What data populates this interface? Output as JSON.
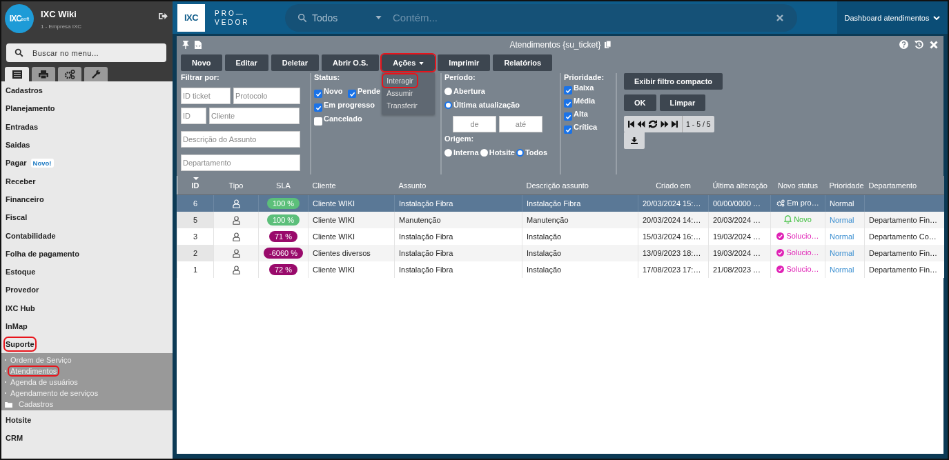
{
  "sidebar": {
    "logo": {
      "main": "IXC",
      "suffix": "soft"
    },
    "title": "IXC Wiki",
    "subtitle": "1 - Empresa IXC",
    "search": {
      "placeholder": "Buscar no menu..."
    },
    "tabs": [
      {
        "kind": "list",
        "selected": true
      },
      {
        "kind": "print",
        "selected": false
      },
      {
        "kind": "gears",
        "selected": false
      },
      {
        "kind": "wrench",
        "selected": false
      }
    ],
    "menu": [
      {
        "label": "Cadastros",
        "highlighted": false
      },
      {
        "label": "Planejamento",
        "highlighted": false
      },
      {
        "label": "Entradas",
        "highlighted": false
      },
      {
        "label": "Saidas",
        "highlighted": false
      },
      {
        "label": "Pagar",
        "badge": "Novo!",
        "highlighted": false
      },
      {
        "label": "Receber",
        "highlighted": false
      },
      {
        "label": "Financeiro",
        "highlighted": false
      },
      {
        "label": "Fiscal",
        "highlighted": false
      },
      {
        "label": "Contabilidade",
        "highlighted": false
      },
      {
        "label": "Folha de pagamento",
        "highlighted": false
      },
      {
        "label": "Estoque",
        "highlighted": false
      },
      {
        "label": "Provedor",
        "highlighted": false
      },
      {
        "label": "IXC Hub",
        "highlighted": false
      },
      {
        "label": "InMap",
        "highlighted": false
      },
      {
        "label": "Suporte",
        "highlighted": true,
        "children": [
          {
            "label": "Ordem de Serviço",
            "kind": "page",
            "highlighted": false
          },
          {
            "label": "Atendimentos",
            "kind": "page",
            "highlighted": true
          },
          {
            "label": "Agenda de usuários",
            "kind": "page",
            "highlighted": false
          },
          {
            "label": "Agendamento de serviços",
            "kind": "page",
            "highlighted": false
          },
          {
            "label": "Cadastros",
            "kind": "folder",
            "highlighted": false
          }
        ]
      },
      {
        "label": "Hotsite",
        "highlighted": false
      },
      {
        "label": "CRM",
        "highlighted": false
      }
    ]
  },
  "header": {
    "logo": {
      "mark": "IXC",
      "line1": "PRO—",
      "line2": "VEDOR"
    },
    "search": {
      "scope": "Todos",
      "placeholder": "Contém..."
    },
    "dashboard": "Dashboard atendimentos"
  },
  "window": {
    "title": "Atendimentos {su_ticket}",
    "toolbar": [
      {
        "label": "Novo",
        "highlighted": false
      },
      {
        "label": "Editar",
        "highlighted": false
      },
      {
        "label": "Deletar",
        "highlighted": false
      },
      {
        "label": "Abrir O.S.",
        "highlighted": false
      },
      {
        "label": "Ações",
        "highlighted": true,
        "menu": [
          {
            "label": "Interagir",
            "highlighted": true
          },
          {
            "label": "Assumir",
            "highlighted": false
          },
          {
            "label": "Transferir",
            "highlighted": false
          }
        ]
      },
      {
        "label": "Imprimir",
        "highlighted": false
      },
      {
        "label": "Relatórios",
        "highlighted": false
      }
    ]
  },
  "filters": {
    "title": "Filtrar por:",
    "field_rows": [
      [
        {
          "placeholder": "ID ticket"
        },
        {
          "placeholder": "Protocolo"
        }
      ],
      [
        {
          "placeholder": "ID"
        },
        {
          "placeholder": "Cliente"
        }
      ],
      [
        {
          "placeholder": "Descrição do Assunto"
        }
      ],
      [
        {
          "placeholder": "Departamento"
        }
      ]
    ],
    "status": {
      "title": "Status:",
      "options": [
        {
          "label": "Novo",
          "checked": true
        },
        {
          "label": "Pende",
          "checked": true
        },
        {
          "label": "Em progresso",
          "checked": true
        },
        {
          "label": "Cancelado",
          "checked": false
        }
      ]
    },
    "period": {
      "title": "Período:",
      "options": [
        {
          "label": "Abertura",
          "selected": false
        },
        {
          "label": "Última atualização",
          "selected": true
        }
      ],
      "from": {
        "placeholder": "de"
      },
      "to": {
        "placeholder": "até"
      }
    },
    "origin": {
      "title": "Origem:",
      "options": [
        {
          "label": "Interna",
          "selected": false
        },
        {
          "label": "Hotsite",
          "selected": false
        },
        {
          "label": "Todos",
          "selected": true
        }
      ]
    },
    "priority": {
      "title": "Prioridade:",
      "options": [
        {
          "label": "Baixa",
          "checked": true
        },
        {
          "label": "Média",
          "checked": true
        },
        {
          "label": "Alta",
          "checked": true
        },
        {
          "label": "Crítica",
          "checked": true
        }
      ]
    },
    "buttons": {
      "compact": "Exibir filtro compacto",
      "ok": "OK",
      "clear": "Limpar"
    },
    "pager": "1 - 5 / 5"
  },
  "table": {
    "columns": [
      {
        "label": "ID",
        "sorted": true
      },
      {
        "label": "Tipo",
        "sorted": false
      },
      {
        "label": "SLA",
        "sorted": false
      },
      {
        "label": "Cliente",
        "sorted": false
      },
      {
        "label": "Assunto",
        "sorted": false
      },
      {
        "label": "Descrição assunto",
        "sorted": false
      },
      {
        "label": "Criado em",
        "sorted": false
      },
      {
        "label": "Última alteração",
        "sorted": false
      },
      {
        "label": "Novo status",
        "sorted": false
      },
      {
        "label": "Prioridade",
        "sorted": false
      },
      {
        "label": "Departamento",
        "sorted": false
      }
    ],
    "rows": [
      {
        "selected": true,
        "id": "6",
        "sla": {
          "text": "100 %",
          "color": "#5cbf7a"
        },
        "client": "Cliente WIKI",
        "subject": "Instalação Fibra",
        "description": "Instalação Fibra",
        "created": "20/03/2024 15:…",
        "updated": "00/00/0000 …",
        "status": {
          "kind": "progress",
          "text": "Em pro…"
        },
        "priority": "Normal"
      },
      {
        "selected": false,
        "id": "5",
        "sla": {
          "text": "100 %",
          "color": "#5cbf7a"
        },
        "client": "Cliente WIKI",
        "subject": "Manutenção",
        "description": "Manutenção",
        "created": "20/03/2024 14:…",
        "updated": "20/03/2024 …",
        "status": {
          "kind": "new",
          "text": "Novo"
        },
        "priority": "Normal",
        "department": "Departamento Fin…"
      },
      {
        "selected": false,
        "id": "3",
        "sla": {
          "text": "71 %",
          "color": "#990a6b"
        },
        "client": "Cliente WIKI",
        "subject": "Instalação Fibra",
        "description": "Instalação",
        "created": "15/03/2024 16:…",
        "updated": "19/03/2024 …",
        "status": {
          "kind": "solved",
          "text": "Solucio…"
        },
        "priority": "Normal",
        "department": "Departamento Co…"
      },
      {
        "selected": false,
        "id": "2",
        "sla": {
          "text": "-6060 %",
          "color": "#990a6b"
        },
        "client": "Clientes diversos",
        "subject": "Instalação Fibra",
        "description": "Instalação",
        "created": "13/09/2023 18:…",
        "updated": "19/03/2024 …",
        "status": {
          "kind": "solved",
          "text": "Solucio…"
        },
        "priority": "Normal",
        "department": "Departamento Fin…"
      },
      {
        "selected": false,
        "id": "1",
        "sla": {
          "text": "72 %",
          "color": "#990a6b"
        },
        "client": "Cliente WIKI",
        "subject": "Instalação Fibra",
        "description": "Instalação",
        "created": "17/08/2023 17:…",
        "updated": "21/08/2023 …",
        "status": {
          "kind": "solved",
          "text": "Solucio…"
        },
        "priority": "Normal",
        "department": "Departamento Fin…"
      }
    ]
  }
}
